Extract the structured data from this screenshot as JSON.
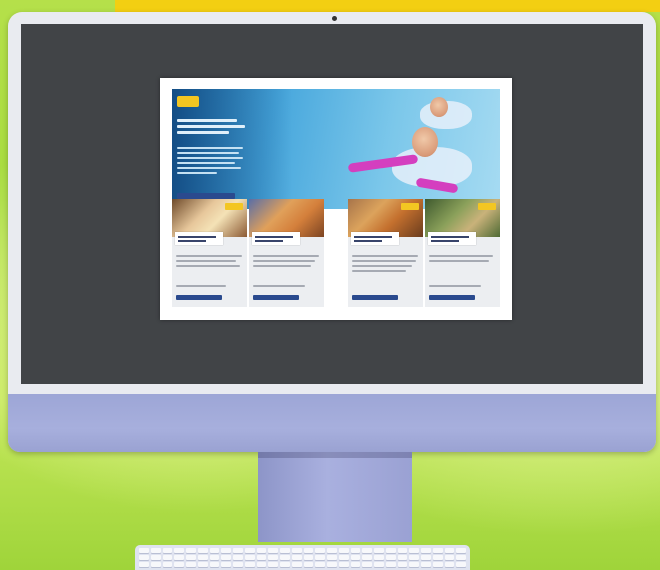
{
  "scene": {
    "subject": "desktop-monitor-showing-website",
    "colors": {
      "background_green": "#a7dc3f",
      "top_band_yellow": "#f3cf12",
      "screen_dark": "#414447",
      "monitor_chin_lavender": "#a7afdd",
      "site_accent_yellow": "#f3c622",
      "site_button_blue": "#2a4a8e",
      "hero_water_blue": "#46a6dc"
    },
    "website": {
      "hero_image": "seniors-swimming-with-pool-noodles",
      "cards": [
        {
          "image": "breakfast-plate-with-egg"
        },
        {
          "image": "fried-food-dish"
        },
        {
          "image": "buffet-dishes"
        },
        {
          "image": "outdoor-garden-scene"
        }
      ]
    }
  }
}
